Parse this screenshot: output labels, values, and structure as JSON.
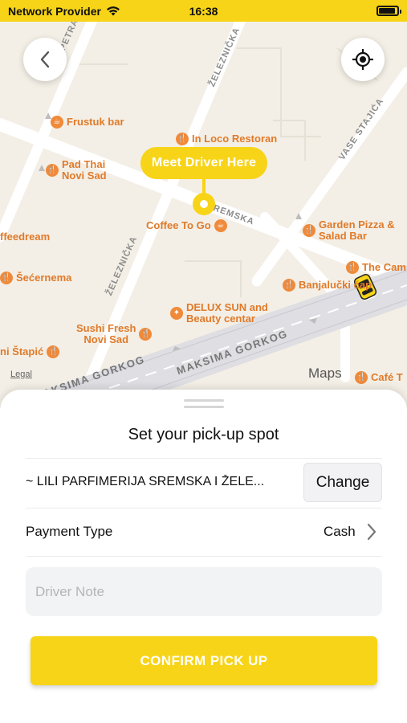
{
  "status_bar": {
    "carrier": "Network Provider",
    "time": "16:38"
  },
  "map": {
    "meet_driver_label": "Meet Driver Here",
    "legal_label": "Legal",
    "maps_logo": "Maps",
    "streets": {
      "petra_drapsina": "PETRA DRAPŠ",
      "zeleznicka_top": "ŽELEZNIČKA",
      "zeleznicka_left": "ŽELEZNIČKA",
      "vase_stajica": "VASE STAJIĆA",
      "sremska": "REMSKA",
      "maksima_gorkog_1": "MAKSIMA GORKOG",
      "maksima_gorkog_2": "MAKSIMA GORKOG",
      "maksima_gorkog_3": "MAKSIMA GORKOG"
    },
    "pois": {
      "frustuk": "Frustuk bar",
      "in_loco": "In Loco Restoran",
      "pad_thai_1": "Pad Thai",
      "pad_thai_2": "Novi Sad",
      "coffee_to_go": "Coffee To Go",
      "garden_pizza_1": "Garden Pizza &",
      "garden_pizza_2": "Salad Bar",
      "freedream": "ffeedream",
      "the_cam": "The Cam",
      "secernema": "Šećernema",
      "banjalucki": "Banjalučki ćap",
      "delux_1": "DELUX SUN and",
      "delux_2": "Beauty centar",
      "sushi_1": "Sushi Fresh",
      "sushi_2": "Novi Sad",
      "stapic": "ni Štapić",
      "cafe": "Café T"
    },
    "colors": {
      "accent": "#f7d417",
      "poi": "#e07a2a",
      "map_bg": "#f3efe6",
      "road": "#ffffff"
    }
  },
  "sheet": {
    "title": "Set your pick-up spot",
    "address": "~ LILI PARFIMERIJA SREMSKA I ŽELE...",
    "change_label": "Change",
    "payment_label": "Payment Type",
    "payment_value": "Cash",
    "driver_note_placeholder": "Driver Note",
    "confirm_label": "CONFIRM PICK UP"
  }
}
